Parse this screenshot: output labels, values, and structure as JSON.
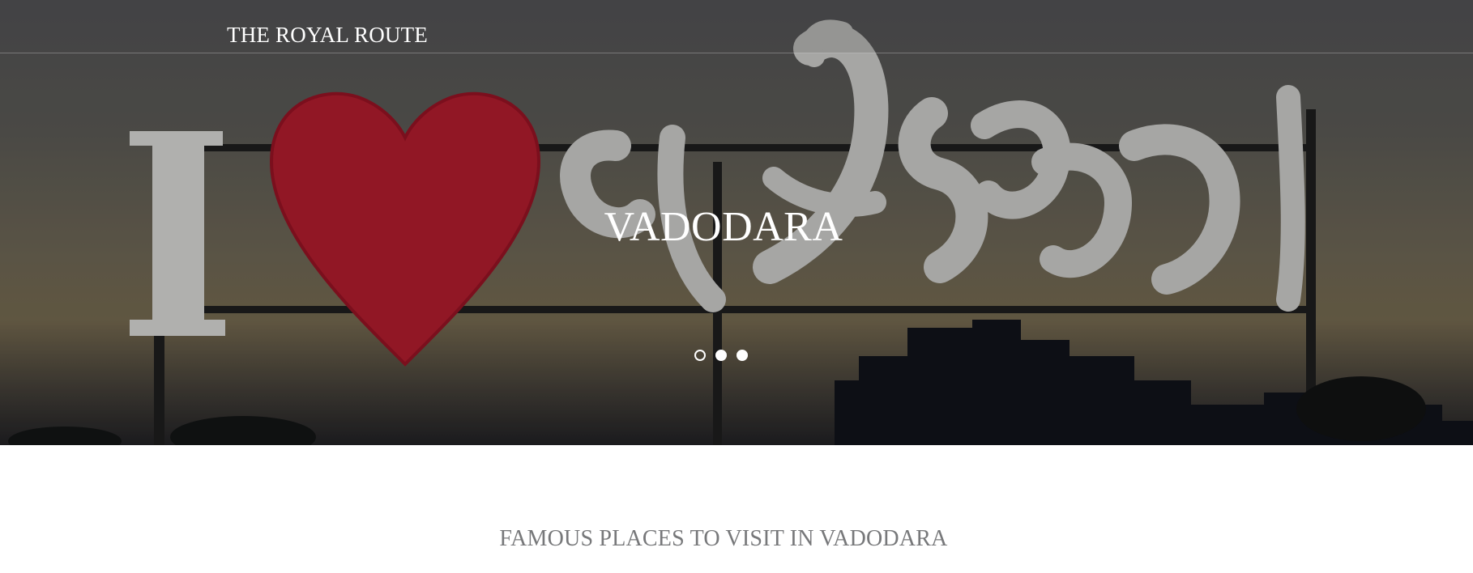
{
  "header": {
    "brand": "THE ROYAL ROUTE"
  },
  "hero": {
    "title": "VADODARA",
    "carousel": {
      "slide_count": 3,
      "active_index": 0
    },
    "background_image": "sign-with-heart-and-gujarati-lettering-at-dusk",
    "heart_color": "#b3182a"
  },
  "content": {
    "section_title": "FAMOUS PLACES TO VISIT IN VADODARA"
  },
  "colors": {
    "section_title": "#77787a",
    "hero_text": "#ffffff"
  }
}
